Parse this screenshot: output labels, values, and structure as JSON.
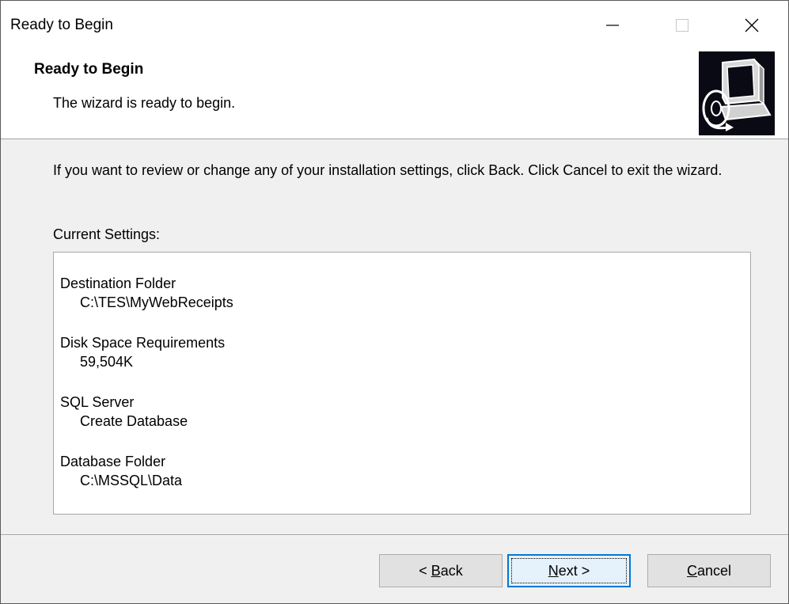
{
  "window": {
    "title": "Ready to Begin"
  },
  "header": {
    "title": "Ready to Begin",
    "subtitle": "The wizard is ready to begin.",
    "icon": "computer-setup-icon"
  },
  "body": {
    "instructions": "If you want to review or change any of your installation settings, click Back. Click Cancel to exit the wizard.",
    "settings_label": "Current Settings:",
    "settings": [
      {
        "name": "Destination Folder",
        "value": "C:\\TES\\MyWebReceipts"
      },
      {
        "name": "Disk Space Requirements",
        "value": "59,504K"
      },
      {
        "name": "SQL Server",
        "value": "Create Database"
      },
      {
        "name": "Database Folder",
        "value": "C:\\MSSQL\\Data"
      }
    ]
  },
  "buttons": {
    "back": {
      "prefix": "< ",
      "accel": "B",
      "rest": "ack"
    },
    "next": {
      "accel": "N",
      "rest": "ext >"
    },
    "cancel": {
      "accel": "C",
      "rest": "ancel"
    }
  },
  "colors": {
    "focus_border": "#0078d7",
    "icon_background": "#0a0a14"
  }
}
